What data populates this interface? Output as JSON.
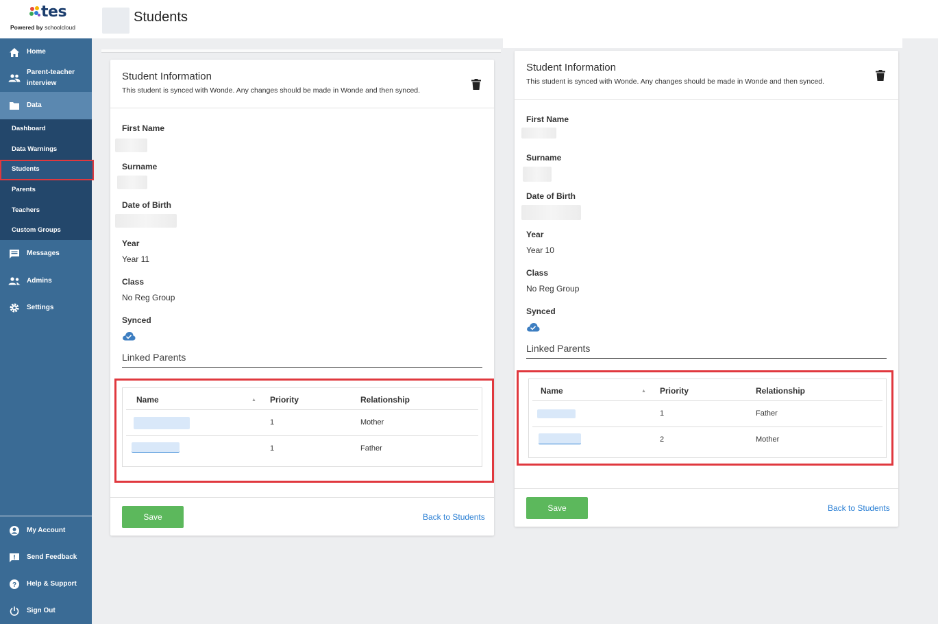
{
  "brand": {
    "logo_text": "tes",
    "powered_prefix": "Powered by",
    "powered_brand": "schoolcloud"
  },
  "header": {
    "title": "Students"
  },
  "sidebar": {
    "items": [
      {
        "label": "Home",
        "icon": "home-icon"
      },
      {
        "label": "Parent-teacher interview",
        "icon": "people-icon"
      },
      {
        "label": "Data",
        "icon": "folder-icon"
      },
      {
        "label": "Messages",
        "icon": "chat-icon"
      },
      {
        "label": "Admins",
        "icon": "admins-icon"
      },
      {
        "label": "Settings",
        "icon": "gear-icon"
      }
    ],
    "data_subitems": [
      "Dashboard",
      "Data Warnings",
      "Students",
      "Parents",
      "Teachers",
      "Custom Groups"
    ],
    "bottom_items": [
      {
        "label": "My Account",
        "icon": "account-icon"
      },
      {
        "label": "Send Feedback",
        "icon": "feedback-icon"
      },
      {
        "label": "Help & Support",
        "icon": "help-icon"
      },
      {
        "label": "Sign Out",
        "icon": "power-icon"
      }
    ]
  },
  "left_card": {
    "title": "Student Information",
    "subtitle": "This student is synced with Wonde. Any changes should be made in Wonde and then synced.",
    "labels": {
      "first_name": "First Name",
      "surname": "Surname",
      "dob": "Date of Birth",
      "year": "Year",
      "class": "Class",
      "synced": "Synced"
    },
    "year_value": "Year 11",
    "class_value": "No Reg Group",
    "linked_parents_title": "Linked Parents",
    "table": {
      "headers": [
        "Name",
        "Priority",
        "Relationship"
      ],
      "rows": [
        {
          "priority": "1",
          "relationship": "Mother"
        },
        {
          "priority": "1",
          "relationship": "Father"
        }
      ]
    },
    "save_label": "Save",
    "back_label": "Back to Students"
  },
  "right_card": {
    "title": "Student Information",
    "subtitle": "This student is synced with Wonde. Any changes should be made in Wonde and then synced.",
    "labels": {
      "first_name": "First Name",
      "surname": "Surname",
      "dob": "Date of Birth",
      "year": "Year",
      "class": "Class",
      "synced": "Synced"
    },
    "year_value": "Year 10",
    "class_value": "No Reg Group",
    "linked_parents_title": "Linked Parents",
    "table": {
      "headers": [
        "Name",
        "Priority",
        "Relationship"
      ],
      "rows": [
        {
          "priority": "1",
          "relationship": "Father"
        },
        {
          "priority": "2",
          "relationship": "Mother"
        }
      ]
    },
    "save_label": "Save",
    "back_label": "Back to Students"
  },
  "colors": {
    "sidebar": "#3a6b95",
    "sidebar_active": "#5b88b0",
    "subnav": "#23476b",
    "highlight": "#e0383e",
    "save": "#5cb85c",
    "link": "#2a7fd4"
  }
}
